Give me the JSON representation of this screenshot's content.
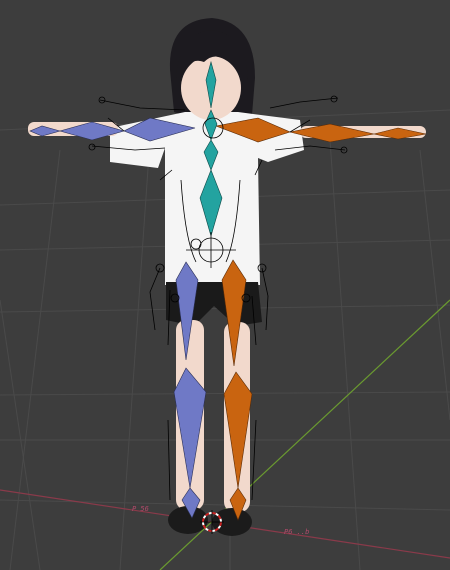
{
  "viewport": {
    "background": "#3d3d3d",
    "grid_color": "#4a4a4a",
    "x_axis_color": "#8a3a4a",
    "y_axis_color": "#6a9a30"
  },
  "character": {
    "hair_color": "#1c1a1f",
    "skin_color": "#f2d9cc",
    "shirt_color": "#f5f5f5",
    "shorts_color": "#1a1a1a",
    "shoe_color": "#1b1b1b"
  },
  "armature": {
    "left_color": "#6f79c6",
    "right_color": "#c96410",
    "spine_color": "#23a3a0",
    "wire_color": "#000000"
  },
  "labels": {
    "left_foot": "P 56",
    "right_foot": "P6 ..b"
  },
  "cursor": {
    "icon": "3d-cursor-icon",
    "ring_colors": [
      "#cc2222",
      "#ffffff"
    ]
  }
}
